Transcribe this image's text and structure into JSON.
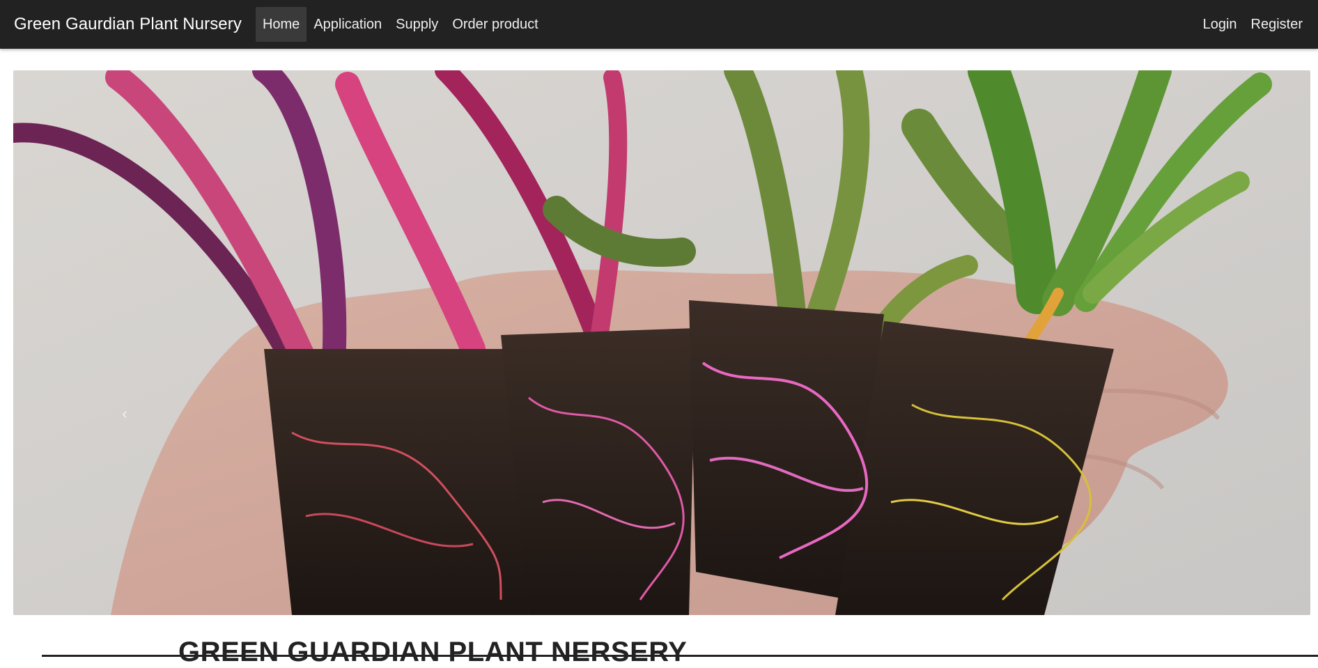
{
  "navbar": {
    "brand": "Green Gaurdian Plant Nursery",
    "left_items": [
      {
        "label": "Home",
        "active": true
      },
      {
        "label": "Application",
        "active": false
      },
      {
        "label": "Supply",
        "active": false
      },
      {
        "label": "Order product",
        "active": false
      }
    ],
    "right_items": [
      {
        "label": "Login"
      },
      {
        "label": "Register"
      }
    ]
  },
  "hero": {
    "prev_glyph": "‹"
  },
  "main": {
    "heading": "GREEN GUARDIAN PLANT NERSERY"
  },
  "colors": {
    "navbar_bg": "#222222",
    "nav_text": "#f0f0f0",
    "active_item_bg": "#3a3a3a"
  }
}
